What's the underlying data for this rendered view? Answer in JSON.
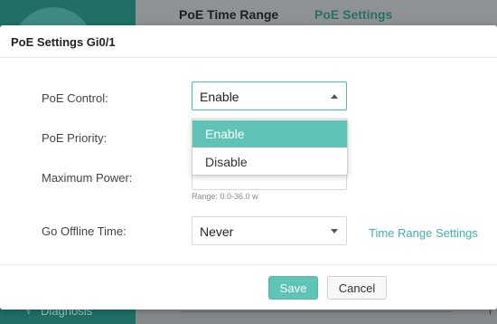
{
  "background": {
    "tabs": [
      "PoE Time Range",
      "PoE Settings"
    ],
    "sidebar_item": "Diagnosis"
  },
  "modal": {
    "title": "PoE Settings Gi0/1",
    "fields": {
      "poe_control": {
        "label": "PoE Control:",
        "value": "Enable"
      },
      "poe_priority": {
        "label": "PoE Priority:"
      },
      "maximum_power": {
        "label": "Maximum Power:",
        "hint": "Range: 0.0-36.0 w"
      },
      "go_offline_time": {
        "label": "Go Offline Time:",
        "value": "Never"
      }
    },
    "dropdown_options": [
      "Enable",
      "Disable"
    ],
    "link": "Time Range Settings",
    "buttons": {
      "save": "Save",
      "cancel": "Cancel"
    }
  },
  "colors": {
    "accent": "#5fc3b6",
    "link": "#3fb2a6"
  }
}
